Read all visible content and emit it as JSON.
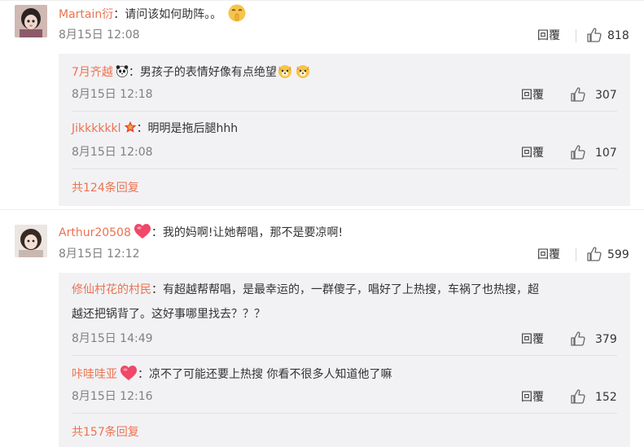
{
  "comments": [
    {
      "username": "Martain衍",
      "text": "：请问该如何助阵。。",
      "time": "8月15日 12:08",
      "reply": "回覆",
      "likes": "818",
      "replies": [
        {
          "username": "7月齐越",
          "text": "：男孩子的表情好像有点绝望",
          "time": "8月15日 12:18",
          "reply": "回覆",
          "likes": "307"
        },
        {
          "username": "Jikkkkkkl",
          "text": "：明明是拖后腿hhh",
          "time": "8月15日 12:08",
          "reply": "回覆",
          "likes": "107"
        }
      ],
      "more": "共124条回复"
    },
    {
      "username": "Arthur20508",
      "text": "：我的妈啊!让她帮唱，那不是要凉啊!",
      "time": "8月15日 12:12",
      "reply": "回覆",
      "likes": "599",
      "replies": [
        {
          "username": "修仙村花的村民",
          "text": "：有超越帮帮唱，是最幸运的，一群傻子，唱好了上热搜，车祸了也热搜，超",
          "text2": "越还把锅背了。这好事哪里找去？？？",
          "time": "8月15日 14:49",
          "reply": "回覆",
          "likes": "379"
        },
        {
          "username": "咔哇哇亚",
          "text": "：凉不了可能还要上热搜 你看不很多人知道他了嘛",
          "time": "8月15日 12:16",
          "reply": "回覆",
          "likes": "152"
        }
      ],
      "more": "共157条回复"
    }
  ],
  "icons": {
    "like": "thumbs-up-icon",
    "shush_emoji": "shushing-face-emoji",
    "dog_emoji": "dog-face-emoji",
    "panda_badge": "panda-icon",
    "star_badge": "red-star-icon",
    "heart_badge": "heart-icon"
  },
  "colors": {
    "username": "#eb7350",
    "text": "#333333",
    "time": "#808080",
    "subbox_bg": "#f2f2f5"
  }
}
